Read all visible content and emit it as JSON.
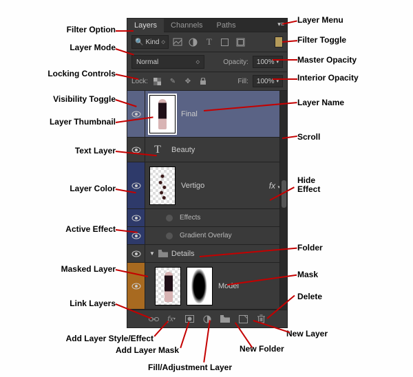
{
  "tabs": {
    "layers": "Layers",
    "channels": "Channels",
    "paths": "Paths"
  },
  "filter": {
    "option_icon": "🔍",
    "kind_label": "Kind"
  },
  "mode": {
    "value": "Normal"
  },
  "opacity": {
    "label": "Opacity:",
    "value": "100%"
  },
  "lock": {
    "label": "Lock:"
  },
  "fill": {
    "label": "Fill:",
    "value": "100%"
  },
  "layers": {
    "final": {
      "name": "Final"
    },
    "beauty": {
      "name": "Beauty"
    },
    "vertigo": {
      "name": "Vertigo",
      "fx": "fx"
    },
    "effects": {
      "label": "Effects"
    },
    "gradov": {
      "label": "Gradient Overlay"
    },
    "details": {
      "name": "Details"
    },
    "model": {
      "name": "Model"
    }
  },
  "callouts": {
    "filter_option": "Filter Option",
    "layer_mode": "Layer Mode",
    "locking_controls": "Locking Controls",
    "visibility_toggle": "Visibility Toggle",
    "layer_thumbnail": "Layer Thumbnail",
    "text_layer": "Text Layer",
    "layer_color": "Layer Color",
    "active_effect": "Active Effect",
    "masked_layer": "Masked Layer",
    "link_layers": "Link Layers",
    "add_style": "Add Layer Style/Effect",
    "add_mask": "Add Layer Mask",
    "fill_adj": "Fill/Adjustment Layer",
    "layer_menu": "Layer Menu",
    "filter_toggle": "Filter Toggle",
    "master_opacity": "Master Opacity",
    "interior_opacity": "Interior Opacity",
    "layer_name": "Layer Name",
    "scroll": "Scroll",
    "hide_effect": "Hide\nEffect",
    "folder": "Folder",
    "mask": "Mask",
    "delete": "Delete",
    "new_layer": "New Layer",
    "new_folder": "New Folder"
  }
}
